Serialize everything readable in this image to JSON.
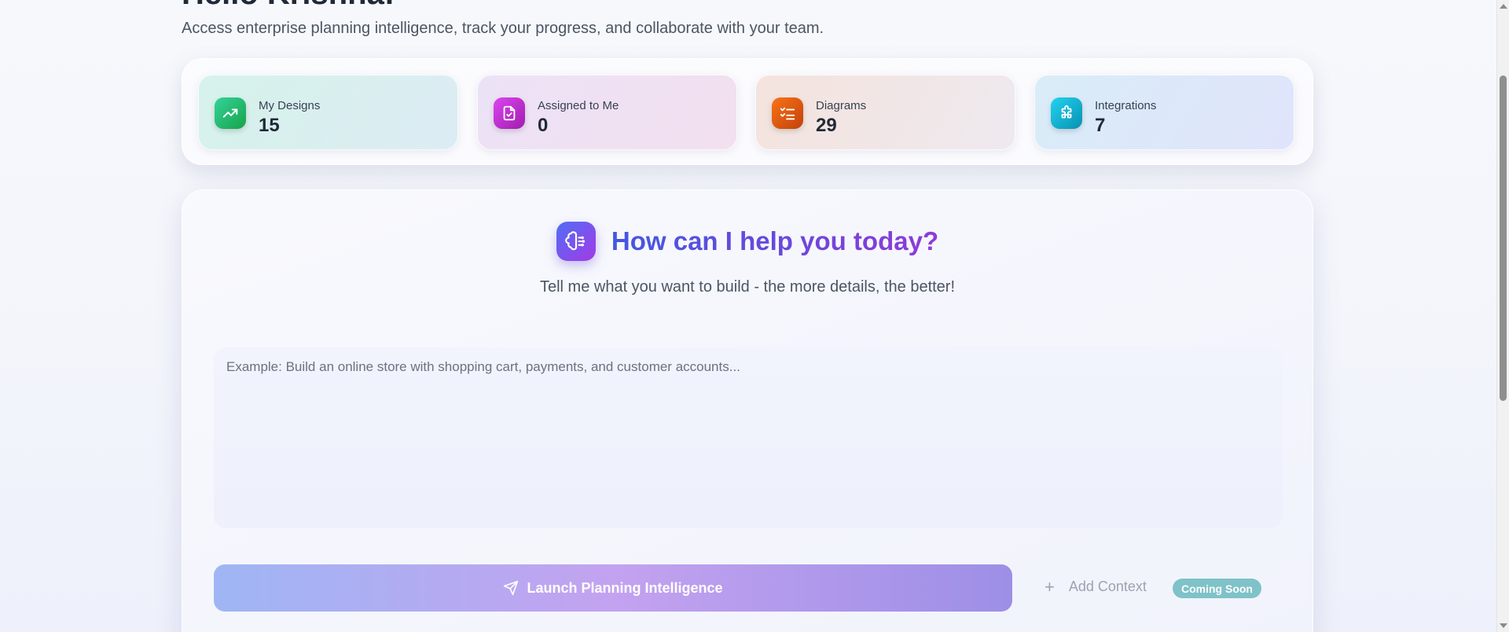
{
  "header": {
    "greeting": "Hello Krishna!",
    "subtitle": "Access enterprise planning intelligence, track your progress, and collaborate with your team."
  },
  "stats": [
    {
      "label": "My Designs",
      "value": "15",
      "icon": "trending-up-icon",
      "color": "#22c55e"
    },
    {
      "label": "Assigned to Me",
      "value": "0",
      "icon": "file-check-icon",
      "color": "#c026d3"
    },
    {
      "label": "Diagrams",
      "value": "29",
      "icon": "list-checks-icon",
      "color": "#ea580c"
    },
    {
      "label": "Integrations",
      "value": "7",
      "icon": "puzzle-icon",
      "color": "#06b6d4"
    }
  ],
  "assistant": {
    "title": "How can I help you today?",
    "subtitle": "Tell me what you want to build - the more details, the better!",
    "prompt_placeholder": "Example: Build an online store with shopping cart, payments, and customer accounts...",
    "prompt_value": "",
    "launch_label": "Launch Planning Intelligence",
    "add_context_label": "Add Context",
    "coming_soon_badge": "Coming Soon"
  },
  "colors": {
    "accent_start": "#4f6ef5",
    "accent_end": "#a33ae6",
    "badge": "#7fc2c8"
  }
}
